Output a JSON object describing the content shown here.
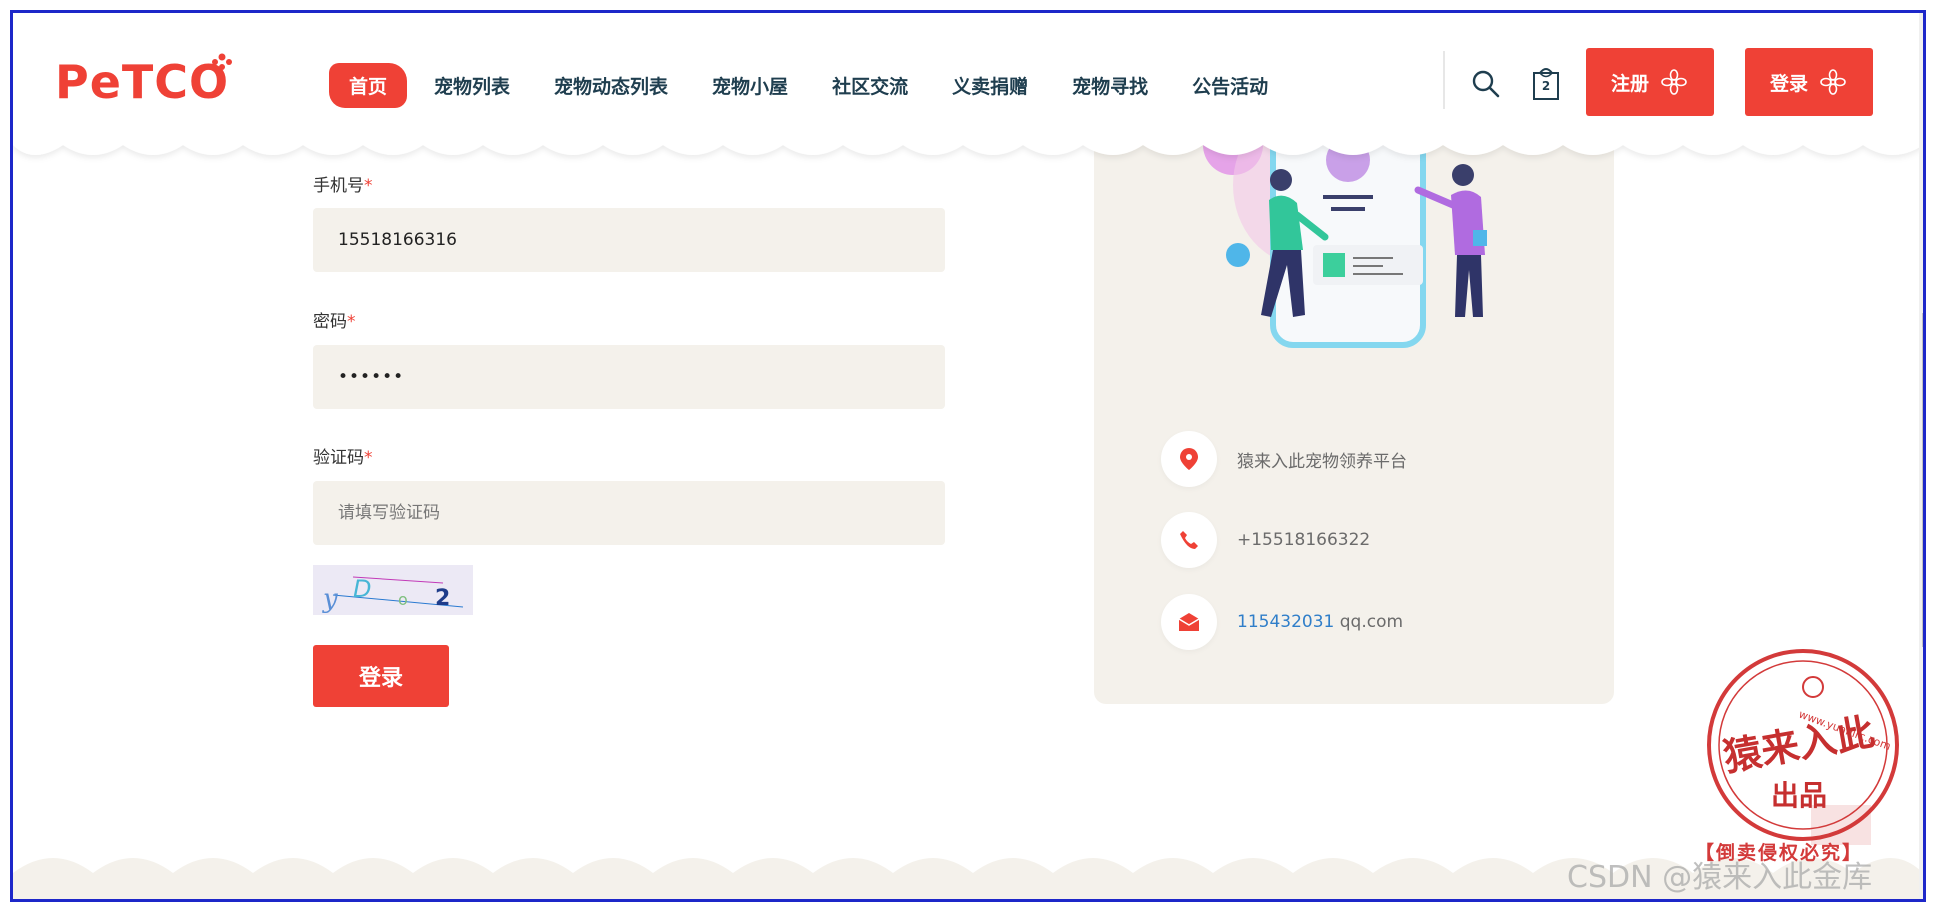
{
  "header": {
    "logo": "PeTCO",
    "nav": [
      {
        "label": "首页",
        "active": true
      },
      {
        "label": "宠物列表",
        "active": false
      },
      {
        "label": "宠物动态列表",
        "active": false
      },
      {
        "label": "宠物小屋",
        "active": false
      },
      {
        "label": "社区交流",
        "active": false
      },
      {
        "label": "义卖捐赠",
        "active": false
      },
      {
        "label": "宠物寻找",
        "active": false
      },
      {
        "label": "公告活动",
        "active": false
      }
    ],
    "bag_count": "2",
    "register_label": "注册",
    "login_label": "登录"
  },
  "form": {
    "phone_label": "手机号",
    "phone_value": "15518166316",
    "password_label": "密码",
    "password_value": "••••••",
    "captcha_label": "验证码",
    "captcha_placeholder": "请填写验证码",
    "required_mark": "*",
    "submit_label": "登录"
  },
  "contact": {
    "address": "猿来入此宠物领养平台",
    "phone": "+15518166322",
    "email_number": "115432031",
    "email_domain": " qq.com"
  },
  "stamp": {
    "text_main": "猿来入此",
    "text_sub": "出品",
    "url": "www.yuanlrc.com",
    "caption": "【倒卖侵权必究】"
  },
  "watermark": "CSDN @猿来入此金库",
  "colors": {
    "brand_red": "#ef4136",
    "nav_text": "#1f3e4f",
    "input_bg": "#f4f1eb",
    "frame_border": "#1d27c9",
    "link_blue": "#2f7ec9"
  }
}
